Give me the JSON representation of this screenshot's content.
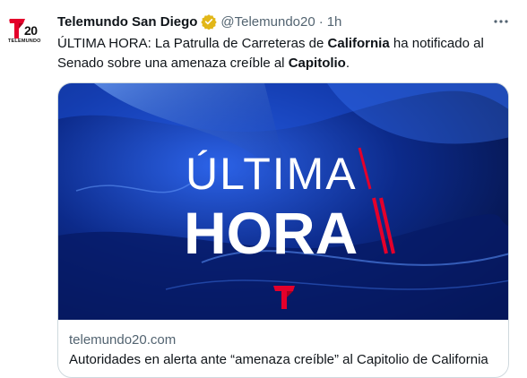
{
  "tweet": {
    "avatar": {
      "number": "20",
      "subtitle": "TELEMUNDO"
    },
    "author_name": "Telemundo San Diego",
    "handle": "@Telemundo20",
    "separator": "·",
    "time": "1h",
    "text_parts": [
      "ÚLTIMA HORA: La Patrulla de Carreteras de ",
      "California",
      " ha notificado al Senado sobre una amenaza creíble al ",
      "Capitolio",
      "."
    ],
    "card": {
      "image_line1": "ÚLTIMA",
      "image_line2": "HORA",
      "domain": "telemundo20.com",
      "title": "Autoridades en alerta ante “amenaza creíble” al Capitolio de California"
    }
  },
  "colors": {
    "brand_red": "#e4002b",
    "verified_gold": "#e2b719",
    "secondary_text": "#536471",
    "card_border": "#cfd9de"
  }
}
